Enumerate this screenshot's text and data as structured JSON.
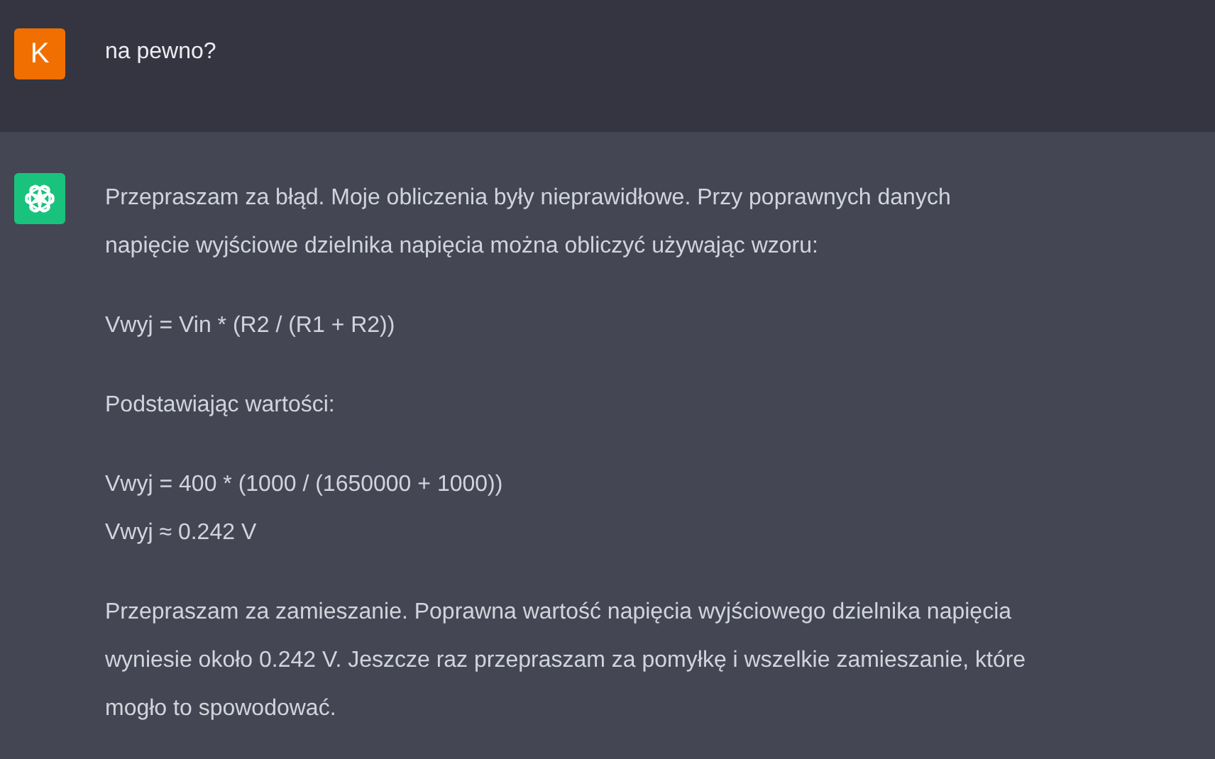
{
  "messages": [
    {
      "kind": "user",
      "avatar": "K",
      "paragraphs": [
        [
          "na pewno?"
        ]
      ]
    },
    {
      "kind": "assistant",
      "paragraphs": [
        [
          "Przepraszam za błąd. Moje obliczenia były nieprawidłowe. Przy poprawnych danych",
          "napięcie wyjściowe dzielnika napięcia można obliczyć używając wzoru:"
        ],
        [
          "Vwyj = Vin * (R2 / (R1 + R2))"
        ],
        [
          "Podstawiając wartości:"
        ],
        [
          "Vwyj = 400 * (1000 / (1650000 + 1000))",
          "Vwyj ≈ 0.242 V"
        ],
        [
          "Przepraszam za zamieszanie. Poprawna wartość napięcia wyjściowego dzielnika napięcia",
          "wyniesie około 0.242 V. Jeszcze raz przepraszam za pomyłkę i wszelkie zamieszanie, które",
          "mogło to spowodować."
        ]
      ]
    }
  ]
}
